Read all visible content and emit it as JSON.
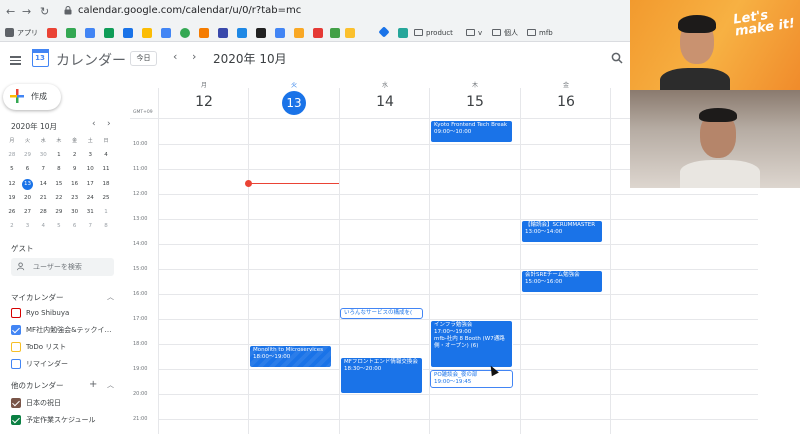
{
  "browser": {
    "url": "calendar.google.com/calendar/u/0/r?tab=mc",
    "bookmarks": [
      "アプリ",
      "product",
      "v",
      "個人",
      "mfb"
    ]
  },
  "header": {
    "app_name": "カレンダー",
    "logo_day": "13",
    "today_label": "今日",
    "month_title": "2020年 10月",
    "prev": "‹",
    "next": "›"
  },
  "sidebar": {
    "create_label": "作成",
    "mini_cal_title": "2020年 10月",
    "weekday_headers": [
      "月",
      "火",
      "水",
      "木",
      "金",
      "土",
      "日"
    ],
    "mini_rows": [
      [
        "28",
        "29",
        "30",
        "1",
        "2",
        "3",
        "4"
      ],
      [
        "5",
        "6",
        "7",
        "8",
        "9",
        "10",
        "11"
      ],
      [
        "12",
        "13",
        "14",
        "15",
        "16",
        "17",
        "18"
      ],
      [
        "19",
        "20",
        "21",
        "22",
        "23",
        "24",
        "25"
      ],
      [
        "26",
        "27",
        "28",
        "29",
        "30",
        "31",
        "1"
      ],
      [
        "2",
        "3",
        "4",
        "5",
        "6",
        "7",
        "8"
      ]
    ],
    "guests_label": "ゲスト",
    "guest_search_placeholder": "ユーザーを検索",
    "my_calendars_label": "マイカレンダー",
    "my_calendars": [
      {
        "name": "Ryo Shibuya",
        "color": "#d50000",
        "checked": false
      },
      {
        "name": "MF社内勉強会&テックイ…",
        "color": "#4285f4",
        "checked": true
      },
      {
        "name": "ToDo リスト",
        "color": "#f6bf26",
        "checked": false
      },
      {
        "name": "リマインダー",
        "color": "#4285f4",
        "checked": false
      }
    ],
    "other_calendars_label": "他のカレンダー",
    "other_calendars": [
      {
        "name": "日本の祝日",
        "color": "#795548",
        "checked": true
      },
      {
        "name": "予定作業スケジュール",
        "color": "#0b8043",
        "checked": true
      }
    ]
  },
  "week": {
    "gmt_label": "GMT+09",
    "days": [
      {
        "dow": "月",
        "num": "12",
        "today": false
      },
      {
        "dow": "火",
        "num": "13",
        "today": true
      },
      {
        "dow": "水",
        "num": "14",
        "today": false
      },
      {
        "dow": "木",
        "num": "15",
        "today": false
      },
      {
        "dow": "金",
        "num": "16",
        "today": false
      }
    ],
    "time_labels": [
      "10:00",
      "11:00",
      "12:00",
      "13:00",
      "14:00",
      "15:00",
      "16:00",
      "17:00",
      "18:00",
      "19:00",
      "20:00",
      "21:00"
    ],
    "events": {
      "kyoto": {
        "title": "Kyoto Frontend Tech Break",
        "time": "09:00～10:00"
      },
      "scrum": {
        "title": "【輪読会】SCRUMMASTER",
        "time": "13:00～14:00"
      },
      "sre": {
        "title": "会計SREチーム勉強会",
        "time": "15:00～16:00"
      },
      "services": {
        "title": "いろんなサービスの構成を("
      },
      "infra": {
        "title": "インフラ勉強会",
        "time": "17:00～19:00",
        "location": "mfb-社内 8 Booth (W7通路側・オープン) (6)"
      },
      "monolith": {
        "title": "Monolith to Microservices",
        "time": "18:00～19:00"
      },
      "frontend": {
        "title": "MFフロントエンド情報交換会",
        "time": "18:30～20:00"
      },
      "po": {
        "title": "PO雑談会_夜の部",
        "time": "19:00～19:45"
      }
    }
  },
  "video": {
    "brand_text": "Let's make it!"
  }
}
